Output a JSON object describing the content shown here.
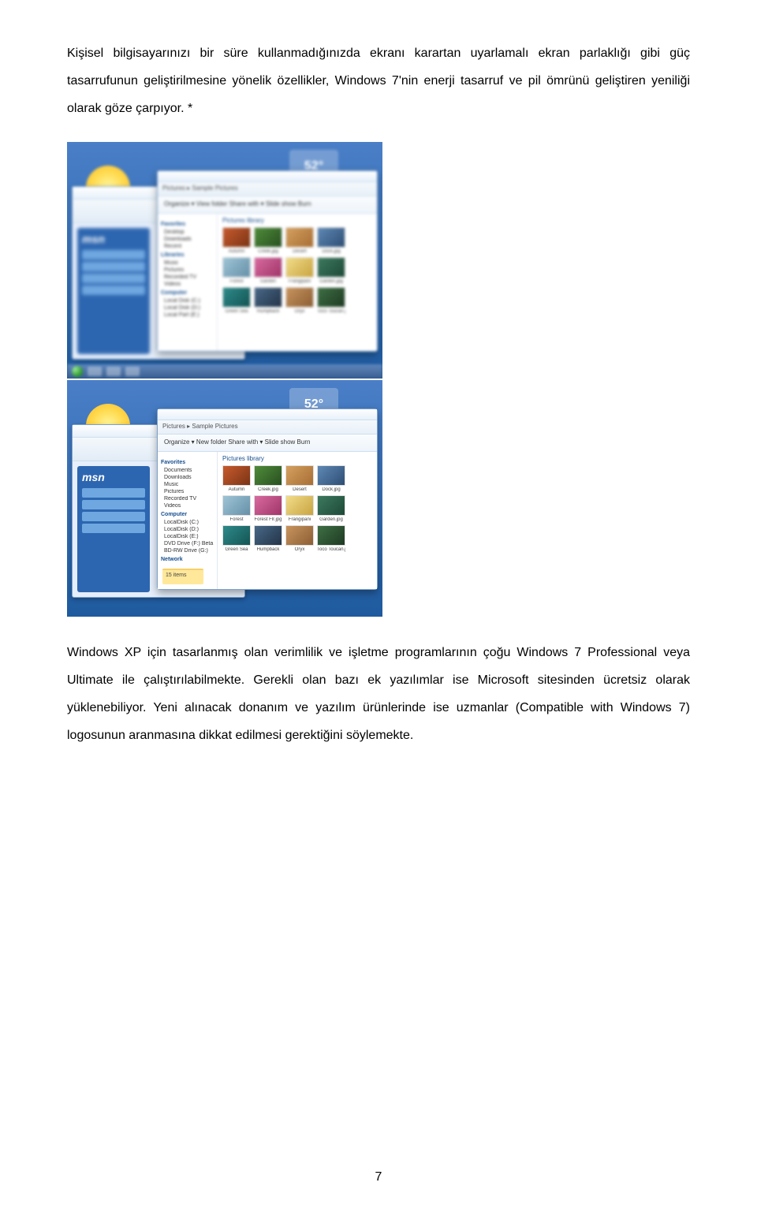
{
  "paragraphs": {
    "p1": "Kişisel bilgisayarınızı bir süre kullanmadığınızda ekranı karartan uyarlamalı ekran parlaklığı gibi güç tasarrufunun geliştirilmesine yönelik özellikler, Windows 7'nin enerji tasarruf ve pil ömrünü geliştiren yeniliği olarak göze çarpıyor. *",
    "p2": "Windows XP için tasarlanmış olan verimlilik ve işletme programlarının çoğu Windows 7 Professional veya Ultimate ile çalıştırılabilmekte. Gerekli olan bazı ek yazılımlar ise Microsoft sitesinden ücretsiz olarak yüklenebiliyor. Yeni alınacak donanım ve yazılım ürünlerinde ise uzmanlar (Compatible with Windows 7) logosunun aranmasına dikkat edilmesi gerektiğini söylemekte."
  },
  "screenshot1": {
    "weather_temp": "52°",
    "msn_logo": "msn",
    "address_bar": "Pictures ▸ Sample Pictures",
    "toolbar_text": "Organize ▾   View folder    Share with ▾   Slide show   Burn",
    "library_title": "Pictures library",
    "nav": {
      "favorites_head": "Favorites",
      "fav_items": [
        "Desktop",
        "Downloads",
        "Recent"
      ],
      "libraries_head": "Libraries",
      "lib_items": [
        "Music",
        "Pictures",
        "Recorded TV",
        "Videos"
      ],
      "computer_head": "Computer",
      "comp_items": [
        "Local Disk (C:)",
        "Local Disk (D:)",
        "Local Part (E:)"
      ]
    },
    "thumbs_row1": [
      "Autumn",
      "Creek.jpg",
      "Desert",
      "Dock.jpg"
    ],
    "thumbs_row2": [
      "Forest",
      "Garden",
      "Frangipani",
      "Garden.jpg"
    ],
    "thumbs_row3": [
      "Green Sea",
      "Humpback",
      "Oryx",
      "Toco Toucan.jpg"
    ]
  },
  "screenshot2": {
    "weather_temp": "52°",
    "msn_logo": "msn",
    "address_bar": "Pictures ▸ Sample Pictures",
    "toolbar_text": "Organize ▾   New folder    Share with ▾   Slide show   Burn",
    "library_title": "Pictures library",
    "nav": {
      "favorites_head": "Favorites",
      "fav_items": [
        "Documents",
        "Downloads",
        "Music",
        "Pictures",
        "Recorded TV",
        "Videos"
      ],
      "computer_head": "Computer",
      "comp_items": [
        "LocalDisk (C:)",
        "LocalDisk (D:)",
        "LocalDisk (E:)",
        "DVD Drive (F:) Beta",
        "BD-RW Drive (G:)"
      ],
      "network_head": "Network"
    },
    "thumbs_row1": [
      "Autumn",
      "Creek.jpg",
      "Desert",
      "Dock.jpg"
    ],
    "thumbs_row2": [
      "Forest",
      "Forest Flr.jpg",
      "Frangipani",
      "Garden.jpg"
    ],
    "thumbs_row3": [
      "Green Sea",
      "Humpback",
      "Oryx",
      "Toco Toucan.jpg"
    ],
    "folder_label": "15 items"
  },
  "colors": {
    "desktop_gradient_top": "#4A7FC7",
    "desktop_gradient_bottom": "#1E5A9E",
    "msn_panel": "#2D66B0",
    "taskbar_top": "#5F87BD",
    "taskbar_bottom": "#3A5E8F"
  },
  "thumb_colors": {
    "autumn": "linear-gradient(135deg,#C85A2E,#7A3414)",
    "creek": "linear-gradient(135deg,#4F8B3A,#285020)",
    "desert": "linear-gradient(135deg,#D4A060,#A86E34)",
    "dock": "linear-gradient(135deg,#5E88B4,#2E4E74)",
    "forest": "linear-gradient(135deg,#9EC4D6,#6690A8)",
    "garden": "linear-gradient(135deg,#D86AA0,#A03468)",
    "frangipani": "linear-gradient(135deg,#F2DC8A,#C8A440)",
    "garden2": "linear-gradient(135deg,#3C785E,#1E4A38)",
    "greensea": "linear-gradient(135deg,#2E8A8A,#145454)",
    "humpback": "linear-gradient(135deg,#486888,#243448)",
    "oryx": "linear-gradient(135deg,#C8945E,#8C5E34)",
    "toucan": "linear-gradient(135deg,#3E6E44,#1E3A22)"
  },
  "page_number": "7"
}
